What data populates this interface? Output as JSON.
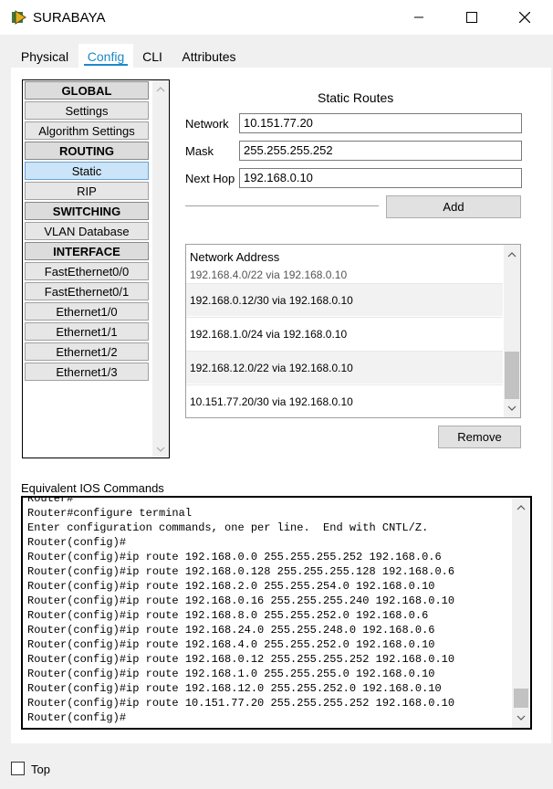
{
  "window": {
    "title": "SURABAYA"
  },
  "tabs": [
    "Physical",
    "Config",
    "CLI",
    "Attributes"
  ],
  "nav": {
    "items": [
      "GLOBAL",
      "Settings",
      "Algorithm Settings",
      "ROUTING",
      "Static",
      "RIP",
      "SWITCHING",
      "VLAN Database",
      "INTERFACE",
      "FastEthernet0/0",
      "FastEthernet0/1",
      "Ethernet1/0",
      "Ethernet1/1",
      "Ethernet1/2",
      "Ethernet1/3"
    ]
  },
  "static_routes": {
    "heading": "Static Routes",
    "network_label": "Network",
    "network_value": "10.151.77.20",
    "mask_label": "Mask",
    "mask_value": "255.255.255.252",
    "nexthop_label": "Next Hop",
    "nexthop_value": "192.168.0.10",
    "add_label": "Add",
    "list_header": "Network Address",
    "rows": [
      "192.168.4.0/22 via 192.168.0.10",
      "192.168.0.12/30 via 192.168.0.10",
      "192.168.1.0/24 via 192.168.0.10",
      "192.168.12.0/22 via 192.168.0.10",
      "10.151.77.20/30 via 192.168.0.10"
    ],
    "remove_label": "Remove"
  },
  "ios": {
    "label": "Equivalent IOS Commands",
    "lines": [
      "Router#",
      "Router#configure terminal",
      "Enter configuration commands, one per line.  End with CNTL/Z.",
      "Router(config)#",
      "Router(config)#ip route 192.168.0.0 255.255.255.252 192.168.0.6",
      "Router(config)#ip route 192.168.0.128 255.255.255.128 192.168.0.6",
      "Router(config)#ip route 192.168.2.0 255.255.254.0 192.168.0.10",
      "Router(config)#ip route 192.168.0.16 255.255.255.240 192.168.0.10",
      "Router(config)#ip route 192.168.8.0 255.255.252.0 192.168.0.6",
      "Router(config)#ip route 192.168.24.0 255.255.248.0 192.168.0.6",
      "Router(config)#ip route 192.168.4.0 255.255.252.0 192.168.0.10",
      "Router(config)#ip route 192.168.0.12 255.255.255.252 192.168.0.10",
      "Router(config)#ip route 192.168.1.0 255.255.255.0 192.168.0.10",
      "Router(config)#ip route 192.168.12.0 255.255.252.0 192.168.0.10",
      "Router(config)#ip route 10.151.77.20 255.255.255.252 192.168.0.10",
      "Router(config)#"
    ]
  },
  "footer": {
    "top_label": "Top"
  }
}
